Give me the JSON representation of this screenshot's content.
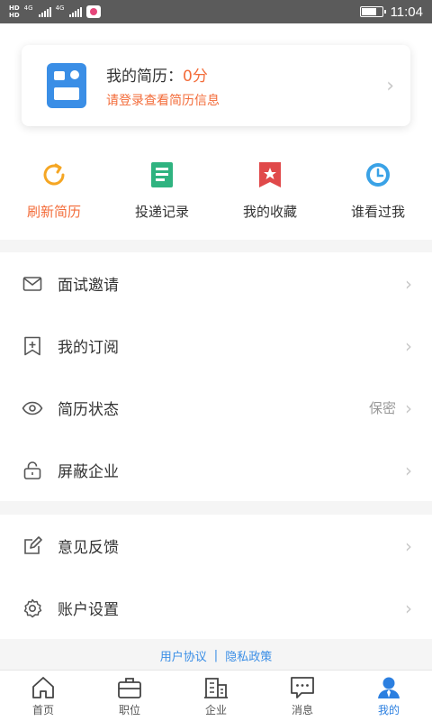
{
  "status_bar": {
    "hd1": "HD",
    "hd2": "HD",
    "net1": "4G",
    "net2": "4G",
    "time": "11:04"
  },
  "resume_card": {
    "title": "我的简历：",
    "score": "0分",
    "subtitle": "请登录查看简历信息",
    "arrow": "›"
  },
  "quick_actions": [
    {
      "label": "刷新简历",
      "icon": "refresh-icon",
      "color": "#f5a623"
    },
    {
      "label": "投递记录",
      "icon": "record-list-icon",
      "color": "#2fb380"
    },
    {
      "label": "我的收藏",
      "icon": "star-bookmark-icon",
      "color": "#e0494a"
    },
    {
      "label": "谁看过我",
      "icon": "clock-icon",
      "color": "#3aa2e6"
    }
  ],
  "menu_group_1": [
    {
      "label": "面试邀请",
      "icon": "mail-icon",
      "value": ""
    },
    {
      "label": "我的订阅",
      "icon": "bookmark-add-icon",
      "value": ""
    },
    {
      "label": "简历状态",
      "icon": "eye-icon",
      "value": "保密"
    },
    {
      "label": "屏蔽企业",
      "icon": "lock-icon",
      "value": ""
    }
  ],
  "menu_group_2": [
    {
      "label": "意见反馈",
      "icon": "edit-icon",
      "value": ""
    },
    {
      "label": "账户设置",
      "icon": "gear-icon",
      "value": ""
    }
  ],
  "footer": {
    "user_agreement": "用户协议",
    "separator": "|",
    "privacy_policy": "隐私政策"
  },
  "tabs": [
    {
      "label": "首页",
      "icon": "home-icon"
    },
    {
      "label": "职位",
      "icon": "briefcase-icon"
    },
    {
      "label": "企业",
      "icon": "building-icon"
    },
    {
      "label": "消息",
      "icon": "message-icon"
    },
    {
      "label": "我的",
      "icon": "user-icon",
      "active": true
    }
  ],
  "colors": {
    "accent_orange": "#f36c3a",
    "accent_blue": "#2b7fe0"
  }
}
